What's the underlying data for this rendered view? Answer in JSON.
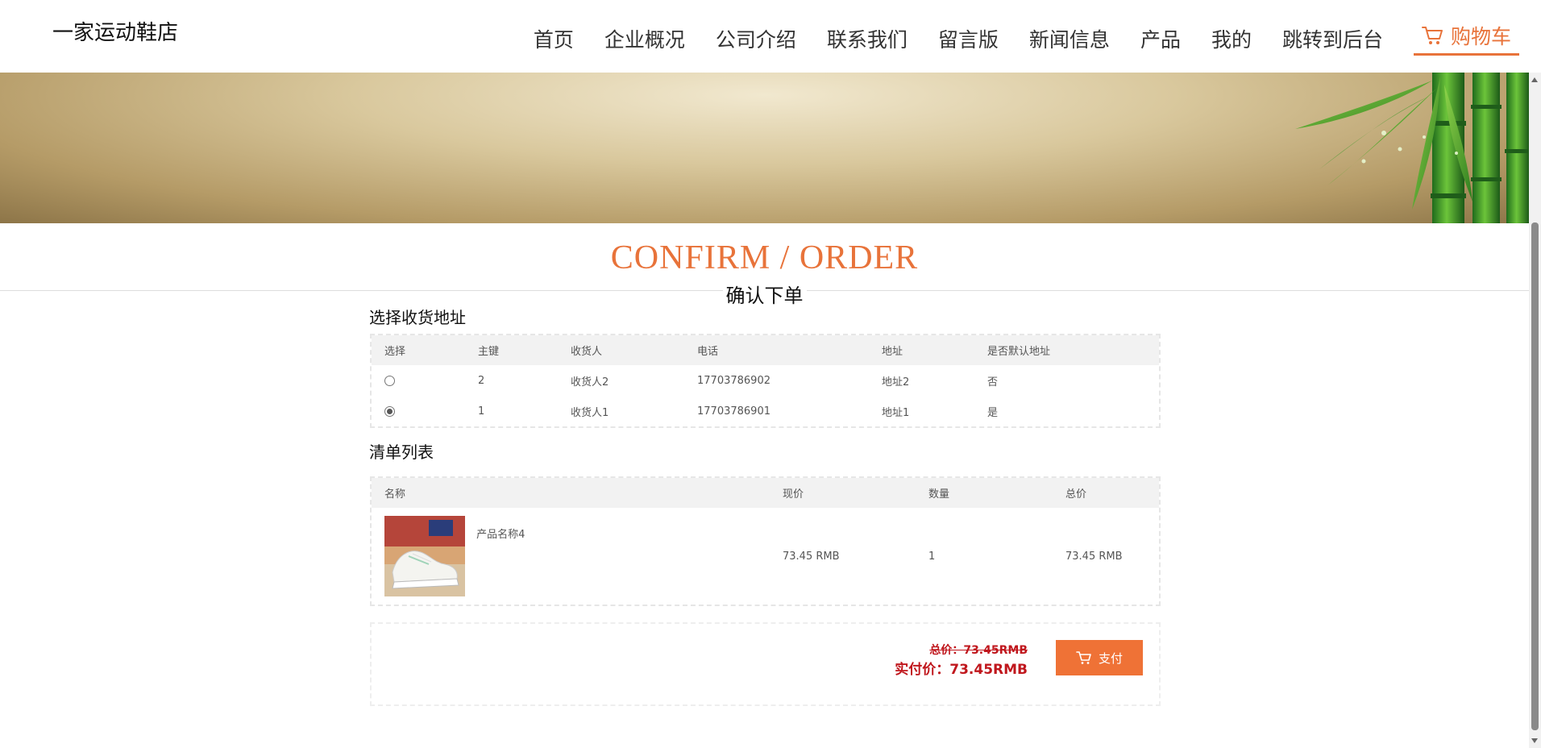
{
  "header": {
    "logo": "一家运动鞋店",
    "nav": [
      "首页",
      "企业概况",
      "公司介绍",
      "联系我们",
      "留言版",
      "新闻信息",
      "产品",
      "我的",
      "跳转到后台"
    ],
    "cart_label": "购物车"
  },
  "title": {
    "en": "CONFIRM / ORDER",
    "zh": "确认下单"
  },
  "address": {
    "section_title": "选择收货地址",
    "headers": [
      "选择",
      "主键",
      "收货人",
      "电话",
      "地址",
      "是否默认地址"
    ],
    "rows": [
      {
        "selected": false,
        "id": "2",
        "receiver": "收货人2",
        "phone": "17703786902",
        "address": "地址2",
        "is_default": "否"
      },
      {
        "selected": true,
        "id": "1",
        "receiver": "收货人1",
        "phone": "17703786901",
        "address": "地址1",
        "is_default": "是"
      }
    ]
  },
  "list": {
    "section_title": "清单列表",
    "headers": [
      "名称",
      "现价",
      "数量",
      "总价"
    ],
    "rows": [
      {
        "name": "产品名称4",
        "price": "73.45 RMB",
        "quantity": "1",
        "total": "73.45 RMB"
      }
    ]
  },
  "payment": {
    "old_price": "总价：73.45RMB",
    "real_price": "实付价：73.45RMB",
    "pay_label": "支付"
  },
  "colors": {
    "accent": "#e8733a",
    "price_red": "#c0171d",
    "pay_button": "#ef7236"
  }
}
